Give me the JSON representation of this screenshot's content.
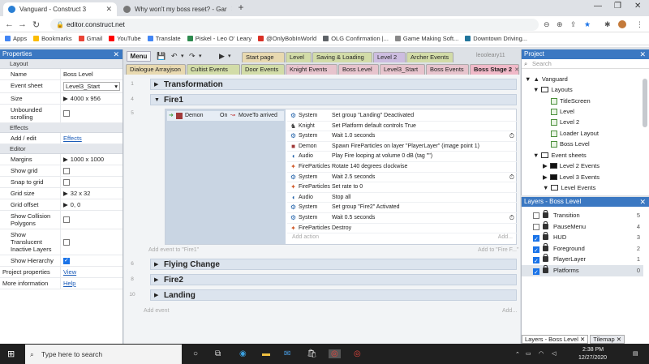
{
  "browser": {
    "tabs": [
      {
        "title": "Vanguard - Construct 3",
        "active": true
      },
      {
        "title": "Why won't my boss reset? - Gar",
        "active": false
      }
    ],
    "new_tab": "+",
    "url": "editor.construct.net",
    "bookmarks": [
      "Apps",
      "Bookmarks",
      "Gmail",
      "YouTube",
      "Translate",
      "Piskel - Leo O' Leary",
      "@OnlyBobInWorld",
      "OLG Confirmation |...",
      "Game Making Soft...",
      "Downtown Driving..."
    ]
  },
  "properties": {
    "header": "Properties",
    "sections": {
      "layout": "Layout",
      "effects": "Effects",
      "editor": "Editor"
    },
    "name_label": "Name",
    "name_value": "Boss Level",
    "sheet_label": "Event sheet",
    "sheet_value": "Level3_Start",
    "size_label": "Size",
    "size_value": "4000 x 956",
    "unbounded_label": "Unbounded scrolling",
    "effects_label": "Add / edit",
    "effects_link": "Effects",
    "margins_label": "Margins",
    "margins_value": "1000 x 1000",
    "showgrid_label": "Show grid",
    "snap_label": "Snap to grid",
    "gridsize_label": "Grid size",
    "gridsize_value": "32 x 32",
    "gridoffset_label": "Grid offset",
    "gridoffset_value": "0, 0",
    "collision_label": "Show Collision Polygons",
    "translucent_label": "Show Translucent Inactive Layers",
    "hierarchy_label": "Show Hierarchy",
    "projprops_label": "Project properties",
    "projprops_link": "View",
    "moreinfo_label": "More information",
    "moreinfo_link": "Help"
  },
  "toolbar": {
    "menu": "Menu",
    "user": "leooleary11",
    "tabs_row1": [
      "Start page",
      "Level",
      "Saving & Loading",
      "Level 2",
      "Archer Events"
    ],
    "tabs_row2": [
      "Dialogue Arrayjson",
      "Cultist Events",
      "Door Events",
      "Knight Events",
      "Boss Level",
      "Level3_Start",
      "Boss Events",
      "Boss Stage 2"
    ]
  },
  "sheet": {
    "groups": [
      {
        "num": "1",
        "name": "Transformation"
      },
      {
        "num": "4",
        "name": "Fire1"
      },
      {
        "num": "6",
        "name": "Flying Change"
      },
      {
        "num": "8",
        "name": "Fire2"
      },
      {
        "num": "10",
        "name": "Landing"
      }
    ],
    "event_num": "5",
    "condition": {
      "object": "Demon",
      "text": "On",
      "trigger": "MoveTo arrived"
    },
    "actions": [
      {
        "icon": "gear-icon",
        "object": "System",
        "text": "Set group \"Landing\" Deactivated"
      },
      {
        "icon": "knight-icon",
        "object": "Knight",
        "text": "Set Platform default controls True"
      },
      {
        "icon": "gear-icon",
        "object": "System",
        "text": "Wait 1.0 seconds",
        "timer": true
      },
      {
        "icon": "demon-icon",
        "object": "Demon",
        "text": "Spawn FireParticles on layer \"PlayerLayer\" (image point 1)"
      },
      {
        "icon": "audio-icon",
        "object": "Audio",
        "text": "Play Fire looping at volume 0 dB (tag \"\")"
      },
      {
        "icon": "particles-icon",
        "object": "FireParticles",
        "text": "Rotate 140 degrees clockwise"
      },
      {
        "icon": "gear-icon",
        "object": "System",
        "text": "Wait 2.5 seconds",
        "timer": true
      },
      {
        "icon": "particles-icon",
        "object": "FireParticles",
        "text": "Set rate to 0"
      },
      {
        "icon": "audio-icon",
        "object": "Audio",
        "text": "Stop all"
      },
      {
        "icon": "gear-icon",
        "object": "System",
        "text": "Set group \"Fire2\" Activated"
      },
      {
        "icon": "gear-icon",
        "object": "System",
        "text": "Wait 0.5 seconds",
        "timer": true
      },
      {
        "icon": "particles-icon",
        "object": "FireParticles",
        "text": "Destroy"
      }
    ],
    "add_action": "Add action",
    "add_event_to": "Add event to \"Fire1\"",
    "add_to_fire": "Add to \"Fire F...\"",
    "add": "Add...",
    "add_event": "Add event"
  },
  "project": {
    "header": "Project",
    "search": "Search",
    "tree": [
      "Vanguard",
      "Layouts",
      "TitleScreen",
      "Level",
      "Level 2",
      "Loader Layout",
      "Boss Level",
      "Event sheets",
      "Level 2 Events",
      "Level 3 Events",
      "Level Events"
    ]
  },
  "layers": {
    "header": "Layers - Boss Level",
    "items": [
      {
        "name": "Transition",
        "count": "5",
        "checked": false
      },
      {
        "name": "PauseMenu",
        "count": "4",
        "checked": false
      },
      {
        "name": "HUD",
        "count": "3",
        "checked": true
      },
      {
        "name": "Foreground",
        "count": "2",
        "checked": true
      },
      {
        "name": "PlayerLayer",
        "count": "1",
        "checked": true
      },
      {
        "name": "Platforms",
        "count": "0",
        "checked": true
      }
    ],
    "tab_layers": "Layers - Boss Level",
    "tab_tilemap": "Tilemap"
  },
  "taskbar": {
    "search": "Type here to search",
    "time": "2:38 PM",
    "date": "12/27/2020"
  }
}
